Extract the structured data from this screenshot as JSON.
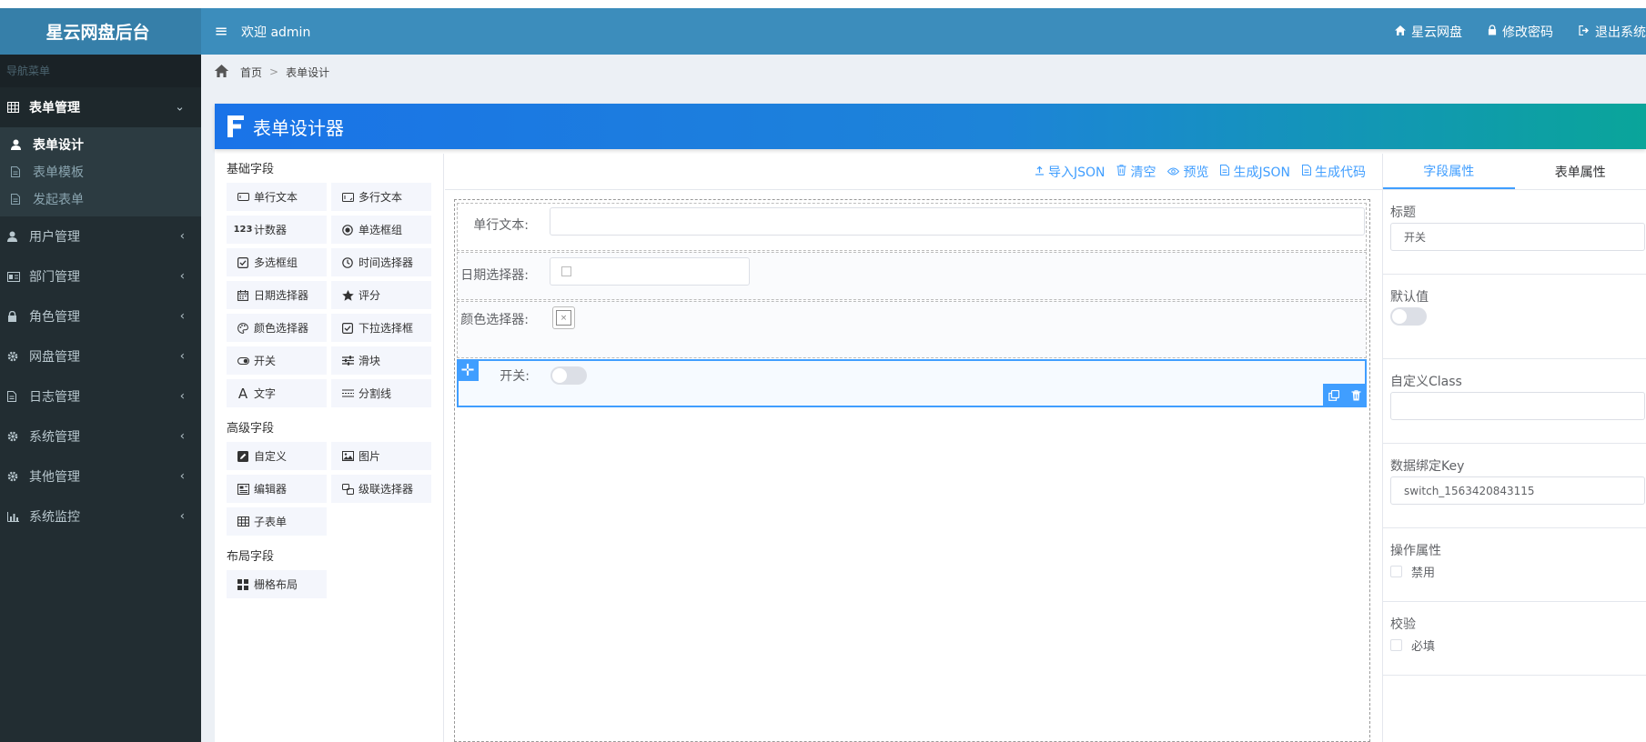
{
  "app": {
    "title": "星云网盘后台"
  },
  "header": {
    "welcome": "欢迎 admin",
    "links": [
      {
        "label": "星云网盘"
      },
      {
        "label": "修改密码"
      },
      {
        "label": "退出系统"
      }
    ]
  },
  "sidebar": {
    "header": "导航菜单",
    "items": [
      {
        "label": "表单管理",
        "icon": "table-icon",
        "expanded": true
      },
      {
        "label": "用户管理",
        "icon": "user-icon"
      },
      {
        "label": "部门管理",
        "icon": "id-card-icon"
      },
      {
        "label": "角色管理",
        "icon": "lock-icon"
      },
      {
        "label": "网盘管理",
        "icon": "gear-icon"
      },
      {
        "label": "日志管理",
        "icon": "file-icon"
      },
      {
        "label": "系统管理",
        "icon": "gear-icon"
      },
      {
        "label": "其他管理",
        "icon": "gear-icon"
      },
      {
        "label": "系统监控",
        "icon": "bar-chart-icon"
      }
    ],
    "subitems": [
      {
        "label": "表单设计",
        "active": true
      },
      {
        "label": "表单模板"
      },
      {
        "label": "发起表单"
      }
    ]
  },
  "breadcrumb": {
    "home": "首页",
    "separator": ">",
    "current": "表单设计"
  },
  "designer": {
    "title": "表单设计器",
    "palette": {
      "basic_title": "基础字段",
      "basic": [
        {
          "label": "单行文本",
          "icon": "input-icon"
        },
        {
          "label": "多行文本",
          "icon": "textarea-icon"
        },
        {
          "label": "计数器",
          "icon": "number-icon"
        },
        {
          "label": "单选框组",
          "icon": "radio-icon"
        },
        {
          "label": "多选框组",
          "icon": "checkbox-icon"
        },
        {
          "label": "时间选择器",
          "icon": "clock-icon"
        },
        {
          "label": "日期选择器",
          "icon": "calendar-icon"
        },
        {
          "label": "评分",
          "icon": "star-icon"
        },
        {
          "label": "颜色选择器",
          "icon": "palette-icon"
        },
        {
          "label": "下拉选择框",
          "icon": "select-icon"
        },
        {
          "label": "开关",
          "icon": "switch-icon"
        },
        {
          "label": "滑块",
          "icon": "slider-icon"
        },
        {
          "label": "文字",
          "icon": "text-icon"
        },
        {
          "label": "分割线",
          "icon": "divider-icon"
        }
      ],
      "advanced_title": "高级字段",
      "advanced": [
        {
          "label": "自定义",
          "icon": "edit-icon"
        },
        {
          "label": "图片",
          "icon": "image-icon"
        },
        {
          "label": "编辑器",
          "icon": "editor-icon"
        },
        {
          "label": "级联选择器",
          "icon": "cascader-icon"
        },
        {
          "label": "子表单",
          "icon": "table-icon"
        }
      ],
      "layout_title": "布局字段",
      "layout": [
        {
          "label": "栅格布局",
          "icon": "grid-icon"
        }
      ]
    },
    "toolbar": [
      {
        "label": "导入JSON",
        "icon": "upload-icon"
      },
      {
        "label": "清空",
        "icon": "trash-icon"
      },
      {
        "label": "预览",
        "icon": "eye-icon"
      },
      {
        "label": "生成JSON",
        "icon": "document-icon"
      },
      {
        "label": "生成代码",
        "icon": "document-icon"
      }
    ],
    "fields": [
      {
        "label": "单行文本:"
      },
      {
        "label": "日期选择器:"
      },
      {
        "label": "颜色选择器:"
      },
      {
        "label": "开关:"
      }
    ],
    "color_clear": "×"
  },
  "props": {
    "tabs": [
      "字段属性",
      "表单属性"
    ],
    "title_label": "标题",
    "title_value": "开关",
    "default_label": "默认值",
    "class_label": "自定义Class",
    "class_value": "",
    "key_label": "数据绑定Key",
    "key_value": "switch_1563420843115",
    "ops_label": "操作属性",
    "disabled_label": "禁用",
    "validate_label": "校验",
    "required_label": "必填"
  },
  "colors": {
    "primary": "#409eff",
    "header": "#3c8dbc",
    "logo": "#367fa9",
    "sidebar": "#222d32"
  }
}
